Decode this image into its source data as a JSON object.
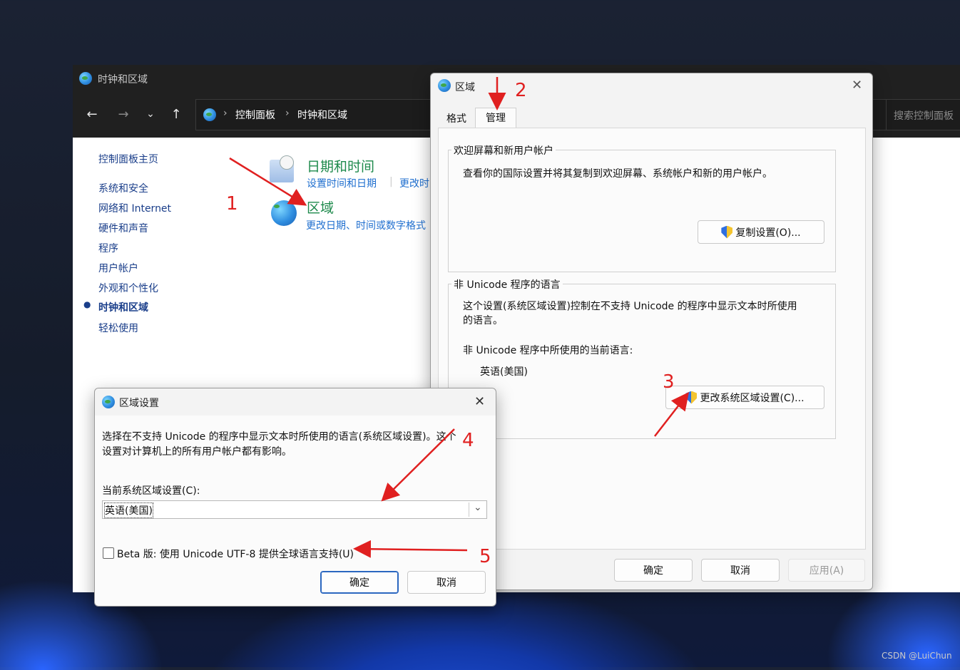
{
  "control_panel": {
    "title": "时钟和区域",
    "breadcrumb": [
      "控制面板",
      "时钟和区域"
    ],
    "search_placeholder": "搜索控制面板",
    "sidebar": [
      {
        "label": "控制面板主页"
      },
      {
        "label": "系统和安全"
      },
      {
        "label": "网络和 Internet"
      },
      {
        "label": "硬件和声音"
      },
      {
        "label": "程序"
      },
      {
        "label": "用户帐户"
      },
      {
        "label": "外观和个性化"
      },
      {
        "label": "时钟和区域",
        "active": true
      },
      {
        "label": "轻松使用"
      }
    ],
    "categories": [
      {
        "title": "日期和时间",
        "links": [
          "设置时间和日期",
          "更改时"
        ]
      },
      {
        "title": "区域",
        "links": [
          "更改日期、时间或数字格式"
        ]
      }
    ]
  },
  "region_dialog": {
    "title": "区域",
    "tabs": [
      "格式",
      "管理"
    ],
    "active_tab": "管理",
    "welcome_group": {
      "label": "欢迎屏幕和新用户帐户",
      "description": "查看你的国际设置并将其复制到欢迎屏幕、系统帐户和新的用户帐户。",
      "button": "复制设置(O)..."
    },
    "non_unicode_group": {
      "label": "非 Unicode 程序的语言",
      "description_line1": "这个设置(系统区域设置)控制在不支持 Unicode 的程序中显示文本时所使用",
      "description_line2": "的语言。",
      "current_label": "非 Unicode 程序中所使用的当前语言:",
      "current_value": "英语(美国)",
      "button": "更改系统区域设置(C)..."
    },
    "buttons": {
      "ok": "确定",
      "cancel": "取消",
      "apply": "应用(A)"
    }
  },
  "locale_dialog": {
    "title": "区域设置",
    "description_line1": "选择在不支持 Unicode 的程序中显示文本时所使用的语言(系统区域设置)。这个",
    "description_line2": "设置对计算机上的所有用户帐户都有影响。",
    "select_label": "当前系统区域设置(C):",
    "select_value": "英语(美国)",
    "beta_checkbox": "Beta 版: 使用 Unicode UTF-8 提供全球语言支持(U)",
    "beta_checked": false,
    "buttons": {
      "ok": "确定",
      "cancel": "取消"
    }
  },
  "annotations": [
    "1",
    "2",
    "3",
    "4",
    "5"
  ],
  "watermark": "CSDN @LuiChun",
  "colors": {
    "annotation_red": "#e02020",
    "link_blue": "#1f6fcf",
    "category_green": "#1e8a4c"
  },
  "icons": [
    "back-arrow-icon",
    "forward-arrow-icon",
    "chevron-down-icon",
    "up-arrow-icon",
    "globe-icon",
    "uac-shield-icon",
    "close-icon",
    "calendar-clock-icon"
  ]
}
